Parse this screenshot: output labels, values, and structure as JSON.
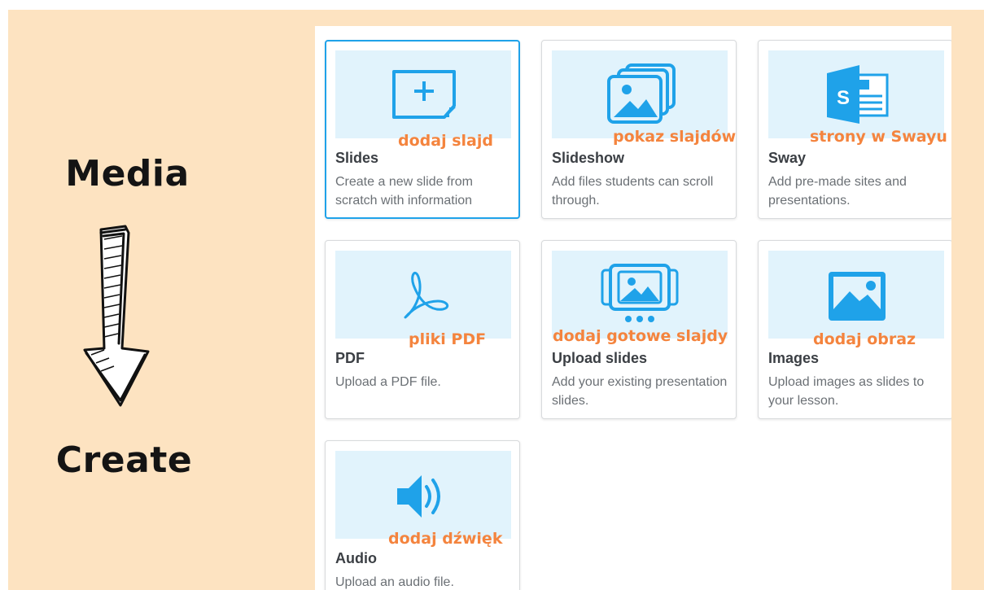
{
  "side": {
    "top_label": "Media",
    "bottom_label": "Create"
  },
  "cards": [
    {
      "id": "slides",
      "title": "Slides",
      "description": "Create a new slide from scratch with information",
      "annotation": "dodaj slajd",
      "icon": "add-slide-icon",
      "selected": true
    },
    {
      "id": "slideshow",
      "title": "Slideshow",
      "description": "Add files students can scroll through.",
      "annotation": "pokaz slajdów",
      "icon": "image-stack-icon"
    },
    {
      "id": "sway",
      "title": "Sway",
      "description": "Add pre-made sites and presentations.",
      "annotation": "strony w Swayu",
      "icon": "sway-logo-icon"
    },
    {
      "id": "pdf",
      "title": "PDF",
      "description": "Upload a PDF file.",
      "annotation": "pliki PDF",
      "icon": "pdf-icon"
    },
    {
      "id": "upload-slides",
      "title": "Upload slides",
      "description": "Add your existing presentation slides.",
      "annotation": "dodaj gotowe slajdy",
      "icon": "upload-slides-icon"
    },
    {
      "id": "images",
      "title": "Images",
      "description": "Upload images as slides to your lesson.",
      "annotation": "dodaj obraz",
      "icon": "image-icon"
    },
    {
      "id": "audio",
      "title": "Audio",
      "description": "Upload an audio file.",
      "annotation": "dodaj dźwięk",
      "icon": "speaker-icon"
    }
  ],
  "colors": {
    "accent": "#1fa2e9",
    "annotation": "#f4843e",
    "background": "#fde3c1",
    "thumb_bg": "#e1f3fc"
  }
}
